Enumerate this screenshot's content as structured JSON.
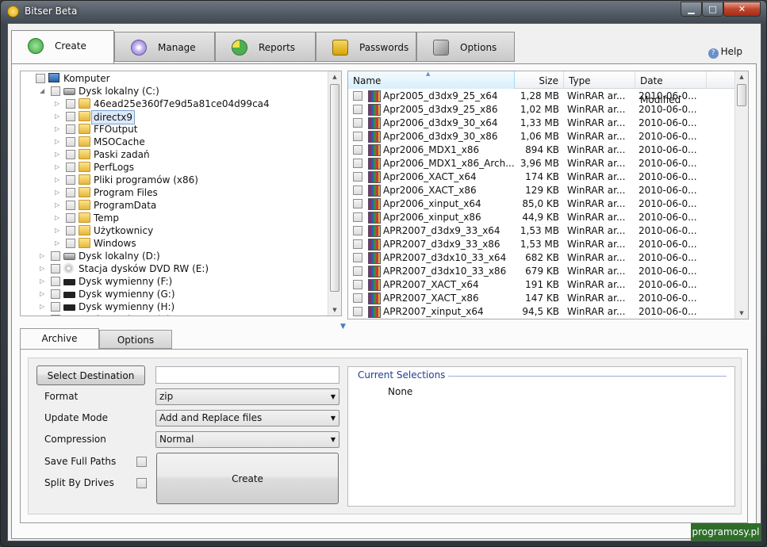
{
  "window": {
    "title": "Bitser Beta",
    "min": "▁",
    "max": "□",
    "close": "✕"
  },
  "tabs": [
    {
      "label": "Create",
      "icon": "plus-icon",
      "color": "#3aa63a"
    },
    {
      "label": "Manage",
      "icon": "atom-icon",
      "color": "#8b6fc9"
    },
    {
      "label": "Reports",
      "icon": "pie-chart-icon",
      "color": "#4caf50"
    },
    {
      "label": "Passwords",
      "icon": "lock-icon",
      "color": "#d9a300"
    },
    {
      "label": "Options",
      "icon": "wrench-icon",
      "color": "#999999"
    }
  ],
  "help": {
    "label": "Help",
    "icon": "?"
  },
  "tree": [
    {
      "label": "Komputer",
      "indent": 0,
      "type": "pc",
      "arrow": ""
    },
    {
      "label": "Dysk lokalny (C:)",
      "indent": 1,
      "type": "drive",
      "arrow": "◢"
    },
    {
      "label": "46ead25e360f7e9d5a81ce04d99ca4",
      "indent": 2,
      "type": "folder",
      "arrow": "▷"
    },
    {
      "label": "directx9",
      "indent": 2,
      "type": "folder",
      "arrow": "▷",
      "selected": true
    },
    {
      "label": "FFOutput",
      "indent": 2,
      "type": "folder",
      "arrow": "▷"
    },
    {
      "label": "MSOCache",
      "indent": 2,
      "type": "folder-lock",
      "arrow": "▷"
    },
    {
      "label": "Paski zadań",
      "indent": 2,
      "type": "folder",
      "arrow": "▷"
    },
    {
      "label": "PerfLogs",
      "indent": 2,
      "type": "folder",
      "arrow": "▷"
    },
    {
      "label": "Pliki programów (x86)",
      "indent": 2,
      "type": "folder",
      "arrow": "▷"
    },
    {
      "label": "Program Files",
      "indent": 2,
      "type": "folder",
      "arrow": "▷"
    },
    {
      "label": "ProgramData",
      "indent": 2,
      "type": "folder",
      "arrow": "▷"
    },
    {
      "label": "Temp",
      "indent": 2,
      "type": "folder",
      "arrow": "▷"
    },
    {
      "label": "Użytkownicy",
      "indent": 2,
      "type": "folder",
      "arrow": "▷"
    },
    {
      "label": "Windows",
      "indent": 2,
      "type": "folder",
      "arrow": "▷"
    },
    {
      "label": "Dysk lokalny (D:)",
      "indent": 1,
      "type": "drive",
      "arrow": "▷"
    },
    {
      "label": "Stacja dysków DVD RW (E:)",
      "indent": 1,
      "type": "dvd",
      "arrow": "▷"
    },
    {
      "label": "Dysk wymienny (F:)",
      "indent": 1,
      "type": "rem",
      "arrow": "▷"
    },
    {
      "label": "Dysk wymienny (G:)",
      "indent": 1,
      "type": "rem",
      "arrow": "▷"
    },
    {
      "label": "Dysk wymienny (H:)",
      "indent": 1,
      "type": "rem",
      "arrow": "▷"
    },
    {
      "label": "Dysk wymienny (I:)",
      "indent": 1,
      "type": "rem",
      "arrow": "▷"
    }
  ],
  "files": {
    "columns": {
      "name": "Name",
      "size": "Size",
      "type": "Type",
      "date": "Date Modified"
    },
    "rows": [
      {
        "name": "Apr2005_d3dx9_25_x64",
        "size": "1,28 MB",
        "type": "WinRAR ar...",
        "date": "2010-06-0..."
      },
      {
        "name": "Apr2005_d3dx9_25_x86",
        "size": "1,02 MB",
        "type": "WinRAR ar...",
        "date": "2010-06-0..."
      },
      {
        "name": "Apr2006_d3dx9_30_x64",
        "size": "1,33 MB",
        "type": "WinRAR ar...",
        "date": "2010-06-0..."
      },
      {
        "name": "Apr2006_d3dx9_30_x86",
        "size": "1,06 MB",
        "type": "WinRAR ar...",
        "date": "2010-06-0..."
      },
      {
        "name": "Apr2006_MDX1_x86",
        "size": "894 KB",
        "type": "WinRAR ar...",
        "date": "2010-06-0..."
      },
      {
        "name": "Apr2006_MDX1_x86_Arch...",
        "size": "3,96 MB",
        "type": "WinRAR ar...",
        "date": "2010-06-0..."
      },
      {
        "name": "Apr2006_XACT_x64",
        "size": "174 KB",
        "type": "WinRAR ar...",
        "date": "2010-06-0..."
      },
      {
        "name": "Apr2006_XACT_x86",
        "size": "129 KB",
        "type": "WinRAR ar...",
        "date": "2010-06-0..."
      },
      {
        "name": "Apr2006_xinput_x64",
        "size": "85,0 KB",
        "type": "WinRAR ar...",
        "date": "2010-06-0..."
      },
      {
        "name": "Apr2006_xinput_x86",
        "size": "44,9 KB",
        "type": "WinRAR ar...",
        "date": "2010-06-0..."
      },
      {
        "name": "APR2007_d3dx9_33_x64",
        "size": "1,53 MB",
        "type": "WinRAR ar...",
        "date": "2010-06-0..."
      },
      {
        "name": "APR2007_d3dx9_33_x86",
        "size": "1,53 MB",
        "type": "WinRAR ar...",
        "date": "2010-06-0..."
      },
      {
        "name": "APR2007_d3dx10_33_x64",
        "size": "682 KB",
        "type": "WinRAR ar...",
        "date": "2010-06-0..."
      },
      {
        "name": "APR2007_d3dx10_33_x86",
        "size": "679 KB",
        "type": "WinRAR ar...",
        "date": "2010-06-0..."
      },
      {
        "name": "APR2007_XACT_x64",
        "size": "191 KB",
        "type": "WinRAR ar...",
        "date": "2010-06-0..."
      },
      {
        "name": "APR2007_XACT_x86",
        "size": "147 KB",
        "type": "WinRAR ar...",
        "date": "2010-06-0..."
      },
      {
        "name": "APR2007_xinput_x64",
        "size": "94,5 KB",
        "type": "WinRAR ar...",
        "date": "2010-06-0..."
      }
    ]
  },
  "bottom": {
    "tabs": [
      "Archive",
      "Options"
    ],
    "select_destination": "Select Destination",
    "destination_value": "",
    "format_label": "Format",
    "format_value": "zip",
    "update_label": "Update Mode",
    "update_value": "Add and Replace files",
    "compression_label": "Compression",
    "compression_value": "Normal",
    "save_paths_label": "Save Full Paths",
    "split_drives_label": "Split By Drives",
    "create_label": "Create",
    "current_selections_title": "Current Selections",
    "current_selections_value": "None"
  },
  "watermark": "programosy.pl"
}
